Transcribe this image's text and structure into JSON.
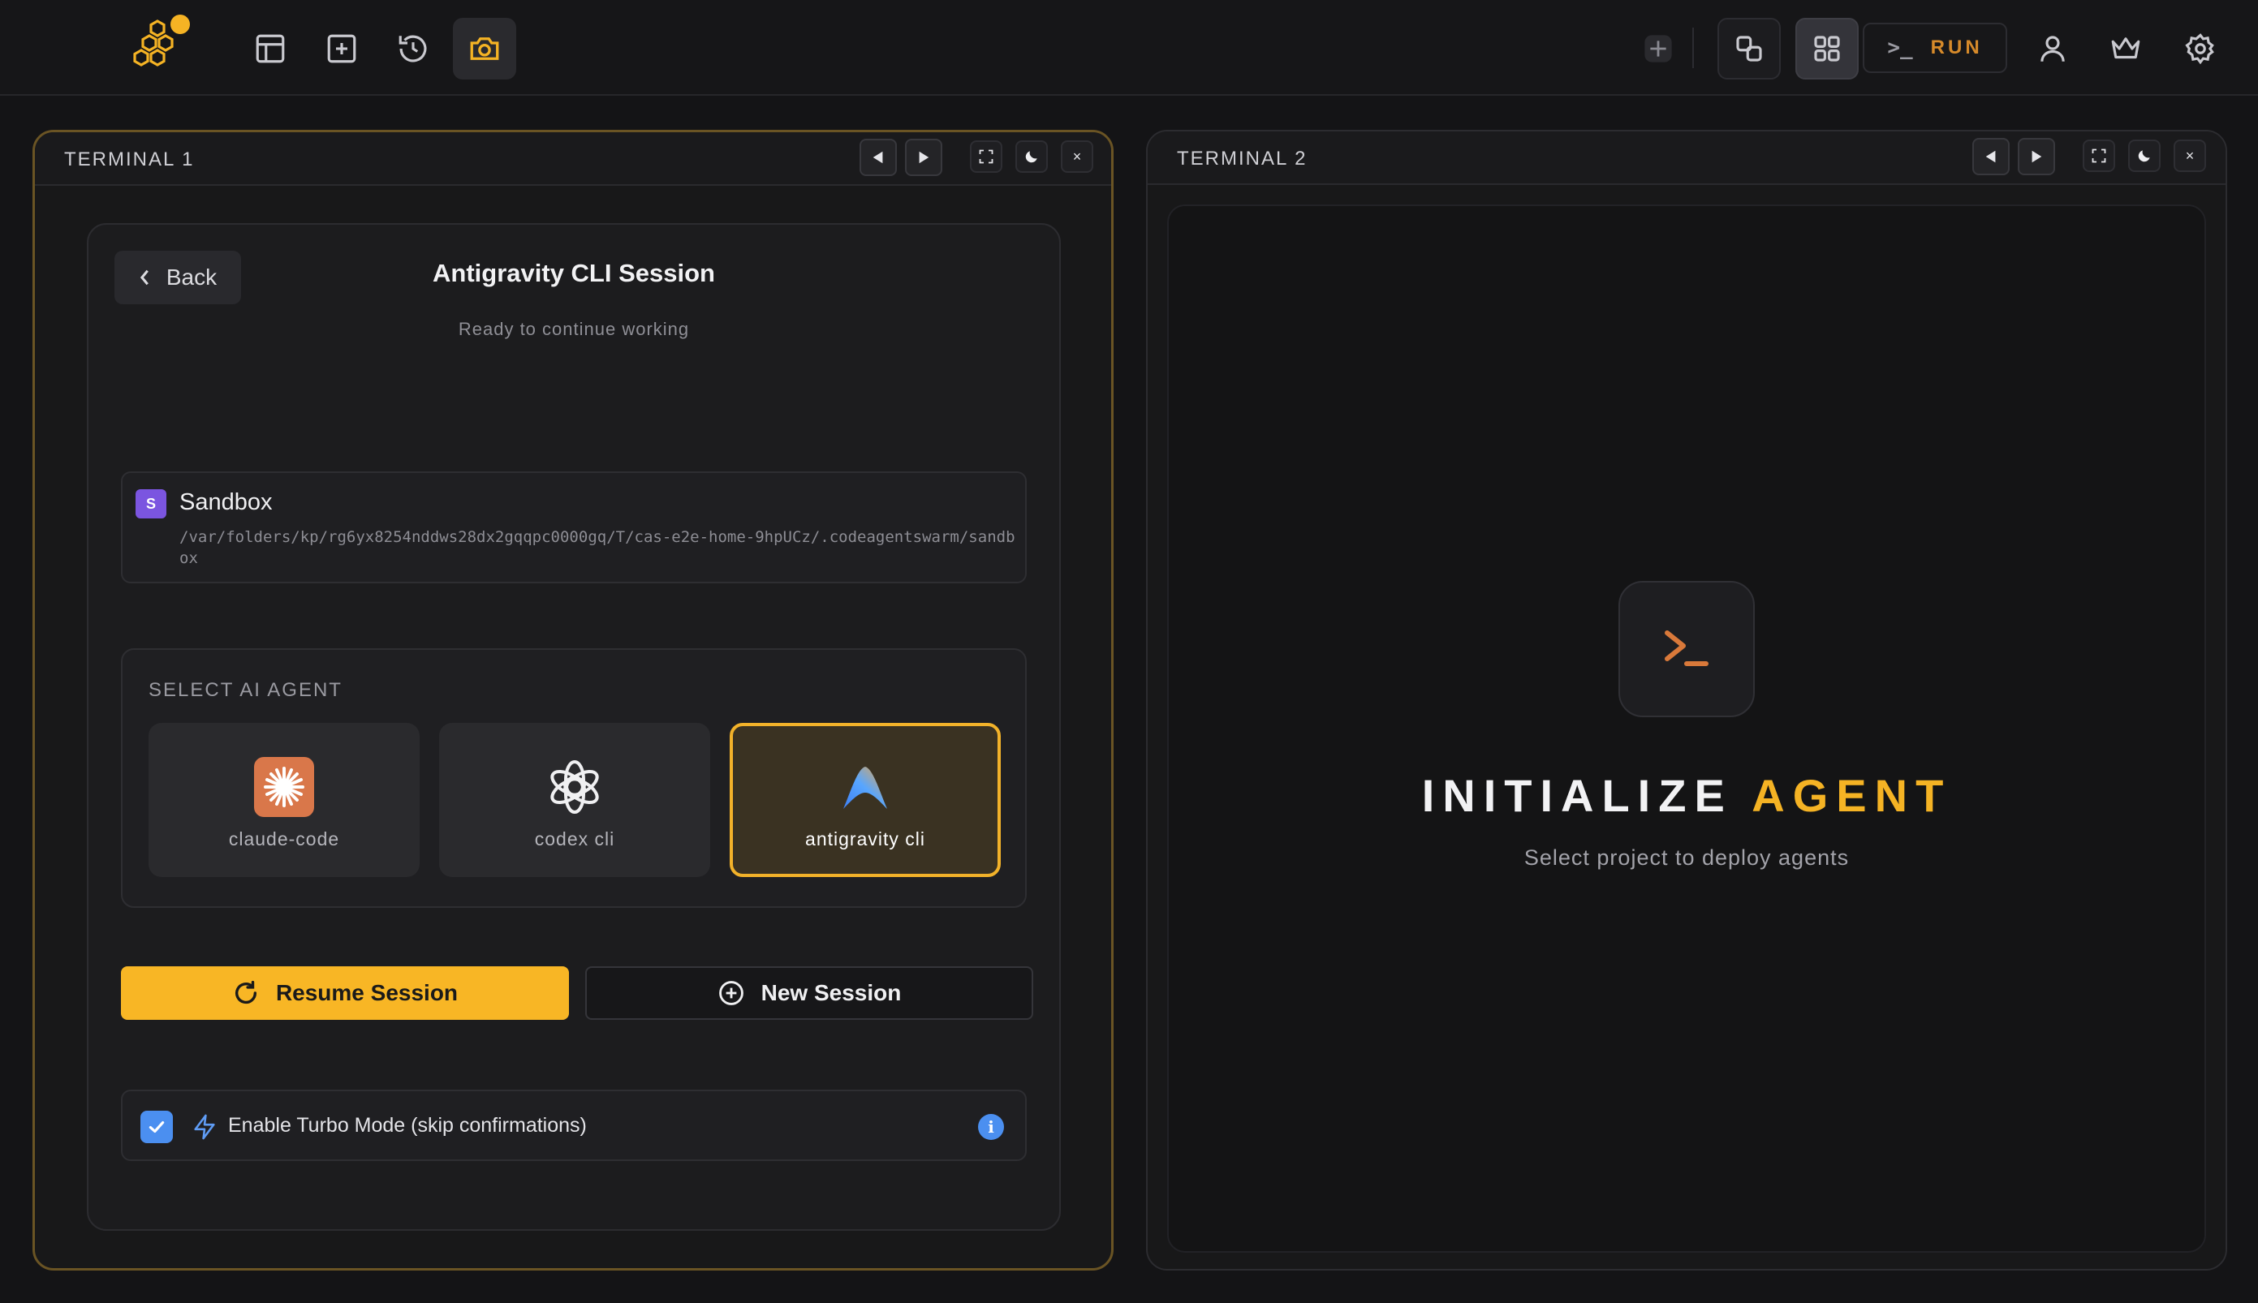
{
  "toolbar": {
    "icons": [
      "layout-icon",
      "new-tab-icon",
      "history-icon",
      "camera-icon"
    ],
    "right_icons": [
      "add-icon",
      "duplicate-icon",
      "grid-icon",
      "user-icon",
      "crown-icon",
      "settings-icon"
    ],
    "run_prompt": ">_",
    "run_label": "RUN",
    "accent": "#f5b324"
  },
  "terminal1": {
    "title": "TERMINAL 1",
    "close_glyph": "×",
    "session": {
      "back_label": "Back",
      "title": "Antigravity CLI Session",
      "subtitle": "Ready to continue working",
      "project": {
        "badge": "S",
        "name": "Sandbox",
        "path": "/var/folders/kp/rg6yx8254nddws28dx2gqqpc0000gq/T/cas-e2e-home-9hpUCz/.codeagentswarm/sandbox"
      },
      "agent_section_label": "SELECT AI AGENT",
      "agents": [
        {
          "name": "claude-code",
          "icon": "claude-icon",
          "selected": false
        },
        {
          "name": "codex cli",
          "icon": "openai-icon",
          "selected": false
        },
        {
          "name": "antigravity cli",
          "icon": "antigravity-icon",
          "selected": true
        }
      ],
      "resume_label": "Resume Session",
      "new_label": "New Session",
      "turbo_label": "Enable Turbo Mode (skip confirmations)",
      "turbo_checked": true,
      "info_glyph": "i"
    }
  },
  "terminal2": {
    "title": "TERMINAL 2",
    "close_glyph": "×",
    "heading_part1": "INITIALIZE",
    "heading_part2": "AGENT",
    "subtitle": "Select project to deploy agents"
  }
}
